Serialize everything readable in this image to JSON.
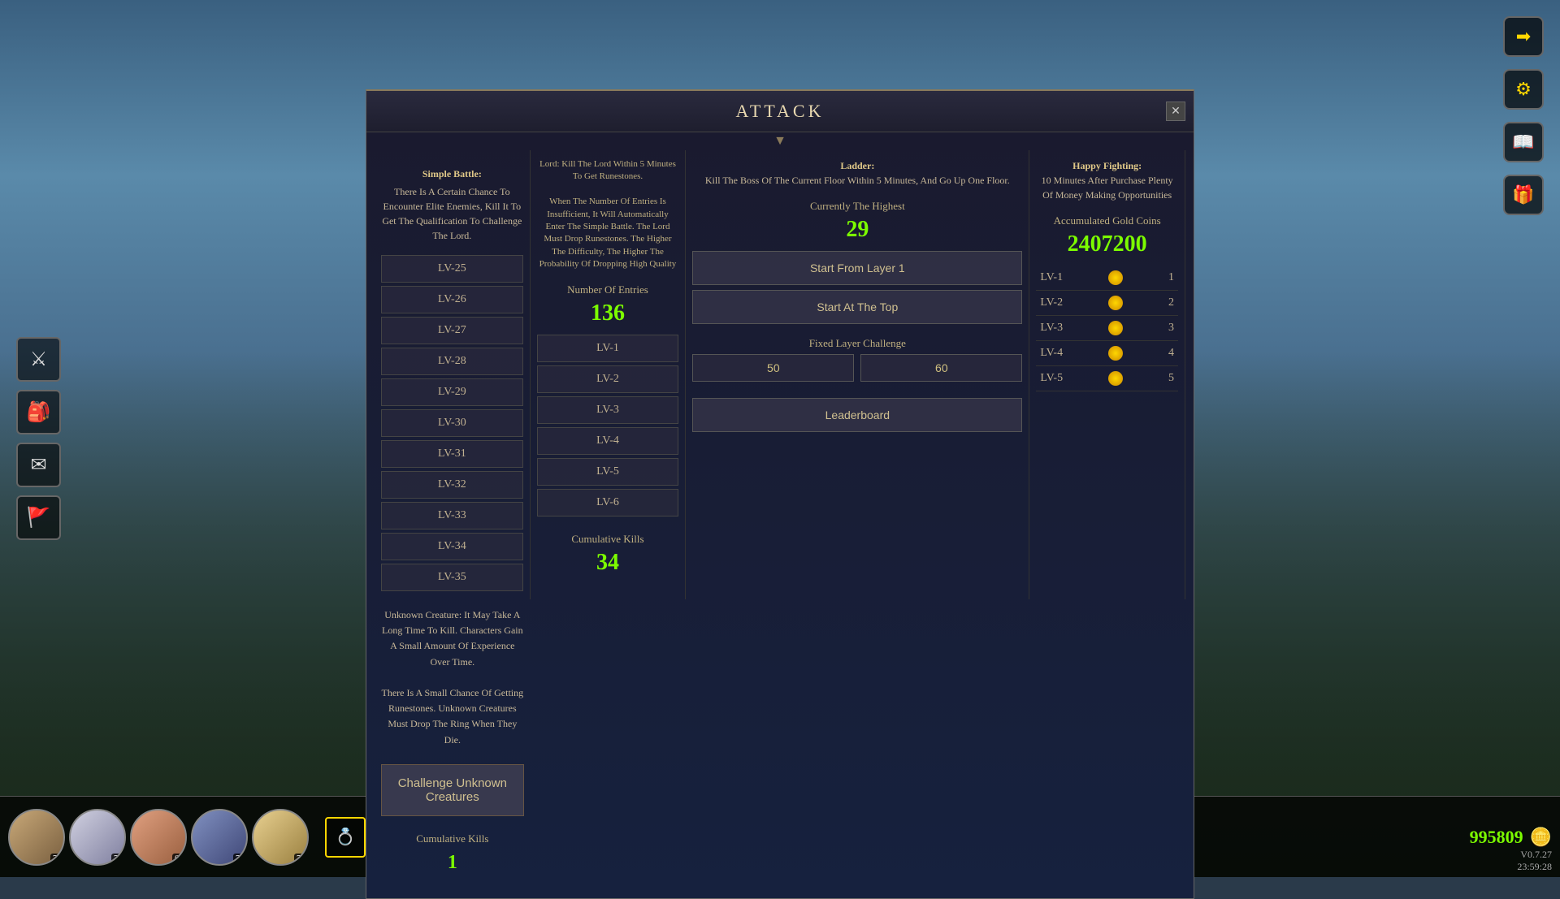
{
  "background": {
    "gradient": "mountain fantasy background"
  },
  "dialog": {
    "title": "ATTACK",
    "close_label": "✕"
  },
  "col1": {
    "description": "Simple Battle:\nThere Is A Certain Chance To Encounter Elite Enemies, Kill It To Get The Qualification To Challenge The Lord.",
    "levels": [
      "LV-25",
      "LV-26",
      "LV-27",
      "LV-28",
      "LV-29",
      "LV-30",
      "LV-31",
      "LV-32",
      "LV-33",
      "LV-34",
      "LV-35"
    ]
  },
  "col2": {
    "header_lines": [
      "Lord: Kill The Lord Within 5 Minutes To Get Runestones.",
      "When The Number Of Entries Is Insufficient, It Will Automatically Enter The Simple Battle. The Lord Must Drop Runestones. The Higher The Difficulty, The Higher The Probability Of Dropping High Quality"
    ],
    "number_of_entries_label": "Number Of Entries",
    "entries_value": "136",
    "entries": [
      "LV-1",
      "LV-2",
      "LV-3",
      "LV-4",
      "LV-5",
      "LV-6"
    ],
    "cumulative_kills_label": "Cumulative Kills",
    "cumulative_kills_value": "34"
  },
  "col3": {
    "description": "Ladder:\nKill The Boss Of The Current Floor Within 5 Minutes, And Go Up One Floor.",
    "currently_highest_label": "Currently The Highest",
    "currently_highest_value": "29",
    "start_from_layer_label": "Start From Layer 1",
    "start_at_top_label": "Start At The Top",
    "fixed_layer_label": "Fixed Layer Challenge",
    "fixed_layer_val1": "50",
    "fixed_layer_val2": "60",
    "leaderboard_label": "Leaderboard"
  },
  "col4": {
    "description": "Happy Fighting:\n10 Minutes After Purchase Plenty Of Money Making Opportunities",
    "accumulated_gold_label": "Accumulated Gold Coins",
    "accumulated_gold_value": "2407200",
    "rows": [
      {
        "level": "LV-1",
        "value": "1"
      },
      {
        "level": "LV-2",
        "value": "2"
      },
      {
        "level": "LV-3",
        "value": "3"
      },
      {
        "level": "LV-4",
        "value": "4"
      },
      {
        "level": "LV-5",
        "value": "5"
      }
    ]
  },
  "col5": {
    "description": "Unknown Creature: It May Take A Long Time To Kill. Characters Gain A Small Amount Of Experience Over Time.\nThere Is A Small Chance Of Getting Runestones. Unknown Creatures Must Drop The Ring When They Die.",
    "challenge_btn_label": "Challenge Unknown\nCreatures",
    "cumulative_kills_label": "Cumulative Kills",
    "cumulative_kills_value": "1"
  },
  "bottom_bar": {
    "characters": [
      {
        "level": "74"
      },
      {
        "level": "74"
      },
      {
        "level": "66"
      },
      {
        "level": "74"
      },
      {
        "level": "74"
      }
    ],
    "currency_value": "995809",
    "currency_icon": "🪙",
    "version": "V0.7.27",
    "time": "23:59:28"
  },
  "right_icons": {
    "icons": [
      "➡️",
      "⚙️",
      "📖",
      "🎁"
    ]
  },
  "left_icons": {
    "icons": [
      "⚔️",
      "🎒",
      "✉️",
      "🚩"
    ]
  }
}
